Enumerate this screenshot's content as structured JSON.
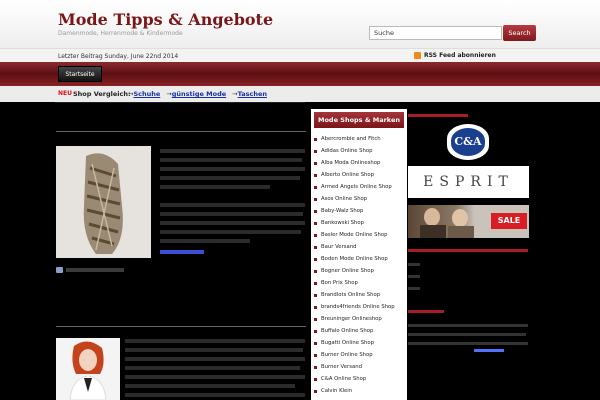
{
  "header": {
    "title": "Mode Tipps & Angebote",
    "tagline": "Damenmode, Herrenmode & Kindermode",
    "search_value": "Suche",
    "search_button": "Search"
  },
  "info_bar": {
    "last_post": "Letzter Beitrag Sunday, June 22nd 2014",
    "rss": "RSS Feed abonnieren"
  },
  "nav": {
    "tabs": [
      {
        "label": "Startseite"
      }
    ]
  },
  "shop_bar": {
    "badge": "NEU",
    "label": "Shop Vergleich:",
    "links": [
      {
        "label": "Schuhe"
      },
      {
        "label": "günstige Mode"
      },
      {
        "label": "Taschen"
      }
    ]
  },
  "sidebar": {
    "heading": "Mode Shops & Marken",
    "items": [
      "Abercrombie and Fitch",
      "Adidas Online Shop",
      "Alba Moda Onlineshop",
      "Alberto Online Shop",
      "Armed Angels Online Shop",
      "Asos Online Shop",
      "Baby-Walz Shop",
      "Bankowski Shop",
      "Basler Mode Online Shop",
      "Baur Versand",
      "Boden Mode Online Shop",
      "Bogner Online Shop",
      "Bon Prix Shop",
      "Brandlots Online Shop",
      "brands4friends Online Shop",
      "Breuninger Onlineshop",
      "Buffalo Online Shop",
      "Bugatti Online Shop",
      "Burner Online Shop",
      "Burner Versand",
      "C&A Online Shop",
      "Calvin Klein"
    ]
  },
  "ads": {
    "ca_logo": "C&A",
    "esprit_logo": "ESPRIT",
    "sale_label": "SALE"
  },
  "colors": {
    "brand": "#7a1518",
    "link": "#1a2fa5",
    "nav_dark": "#5a0f12",
    "new_badge": "#d11111"
  }
}
